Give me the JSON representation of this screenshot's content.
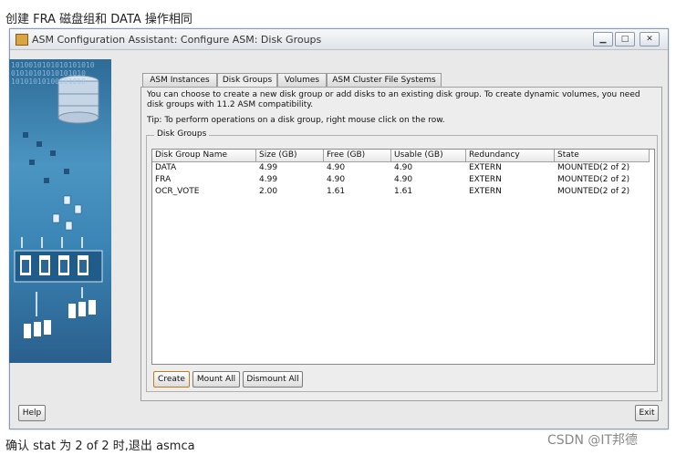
{
  "captions": {
    "top": "创建 FRA 磁盘组和 DATA 操作相同",
    "bottom": "确认 stat 为 2 of 2 时,退出 asmca"
  },
  "window": {
    "title": "ASM Configuration Assistant: Configure ASM: Disk Groups",
    "controls": [
      "minimize-icon",
      "maximize-icon",
      "close-icon"
    ]
  },
  "tabs": [
    {
      "label": "ASM Instances",
      "active": false
    },
    {
      "label": "Disk Groups",
      "active": true
    },
    {
      "label": "Volumes",
      "active": false
    },
    {
      "label": "ASM Cluster File Systems",
      "active": false
    }
  ],
  "description": "You can choose to create a new disk group or add disks to an existing disk group. To create dynamic volumes, you need disk groups with 11.2 ASM compatibility.",
  "tip": "Tip: To perform operations on a disk group, right mouse click on the row.",
  "disk_groups": {
    "title": "Disk Groups",
    "columns": [
      "Disk Group Name",
      "Size (GB)",
      "Free (GB)",
      "Usable (GB)",
      "Redundancy",
      "State"
    ],
    "rows": [
      [
        "DATA",
        "4.99",
        "4.90",
        "4.90",
        "EXTERN",
        "MOUNTED(2 of 2)"
      ],
      [
        "FRA",
        "4.99",
        "4.90",
        "4.90",
        "EXTERN",
        "MOUNTED(2 of 2)"
      ],
      [
        "OCR_VOTE",
        "2.00",
        "1.61",
        "1.61",
        "EXTERN",
        "MOUNTED(2 of 2)"
      ]
    ]
  },
  "buttons": {
    "create": "Create",
    "mount_all": "Mount All",
    "dismount_all": "Dismount All",
    "help": "Help",
    "exit": "Exit"
  },
  "banner": {
    "binary_lines": [
      "1010010101010101010",
      "01010101010101010",
      "10101010100101010"
    ]
  },
  "watermark": "CSDN @IT邦德"
}
